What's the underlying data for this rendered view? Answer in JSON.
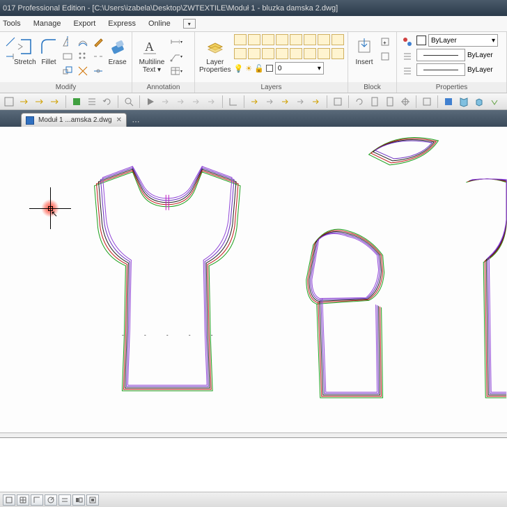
{
  "title": "017 Professional Edition - [C:\\Users\\izabela\\Desktop\\ZWTEXTILE\\Moduł 1 - bluzka damska 2.dwg]",
  "menu": {
    "tools": "Tools",
    "manage": "Manage",
    "export": "Export",
    "express": "Express",
    "online": "Online"
  },
  "ribbon": {
    "modify": {
      "label": "Modify",
      "stretch": "Stretch",
      "fillet": "Fillet",
      "erase": "Erase"
    },
    "annotation": {
      "label": "Annotation",
      "mtext": "Multiline\nText ▾"
    },
    "layers": {
      "label": "Layers",
      "lprops": "Layer\nProperties"
    },
    "block": {
      "label": "Block",
      "insert": "Insert"
    },
    "properties": {
      "label": "Properties",
      "bylayer": "ByLayer"
    }
  },
  "doc_tab": "Moduł 1 ...amska 2.dwg"
}
